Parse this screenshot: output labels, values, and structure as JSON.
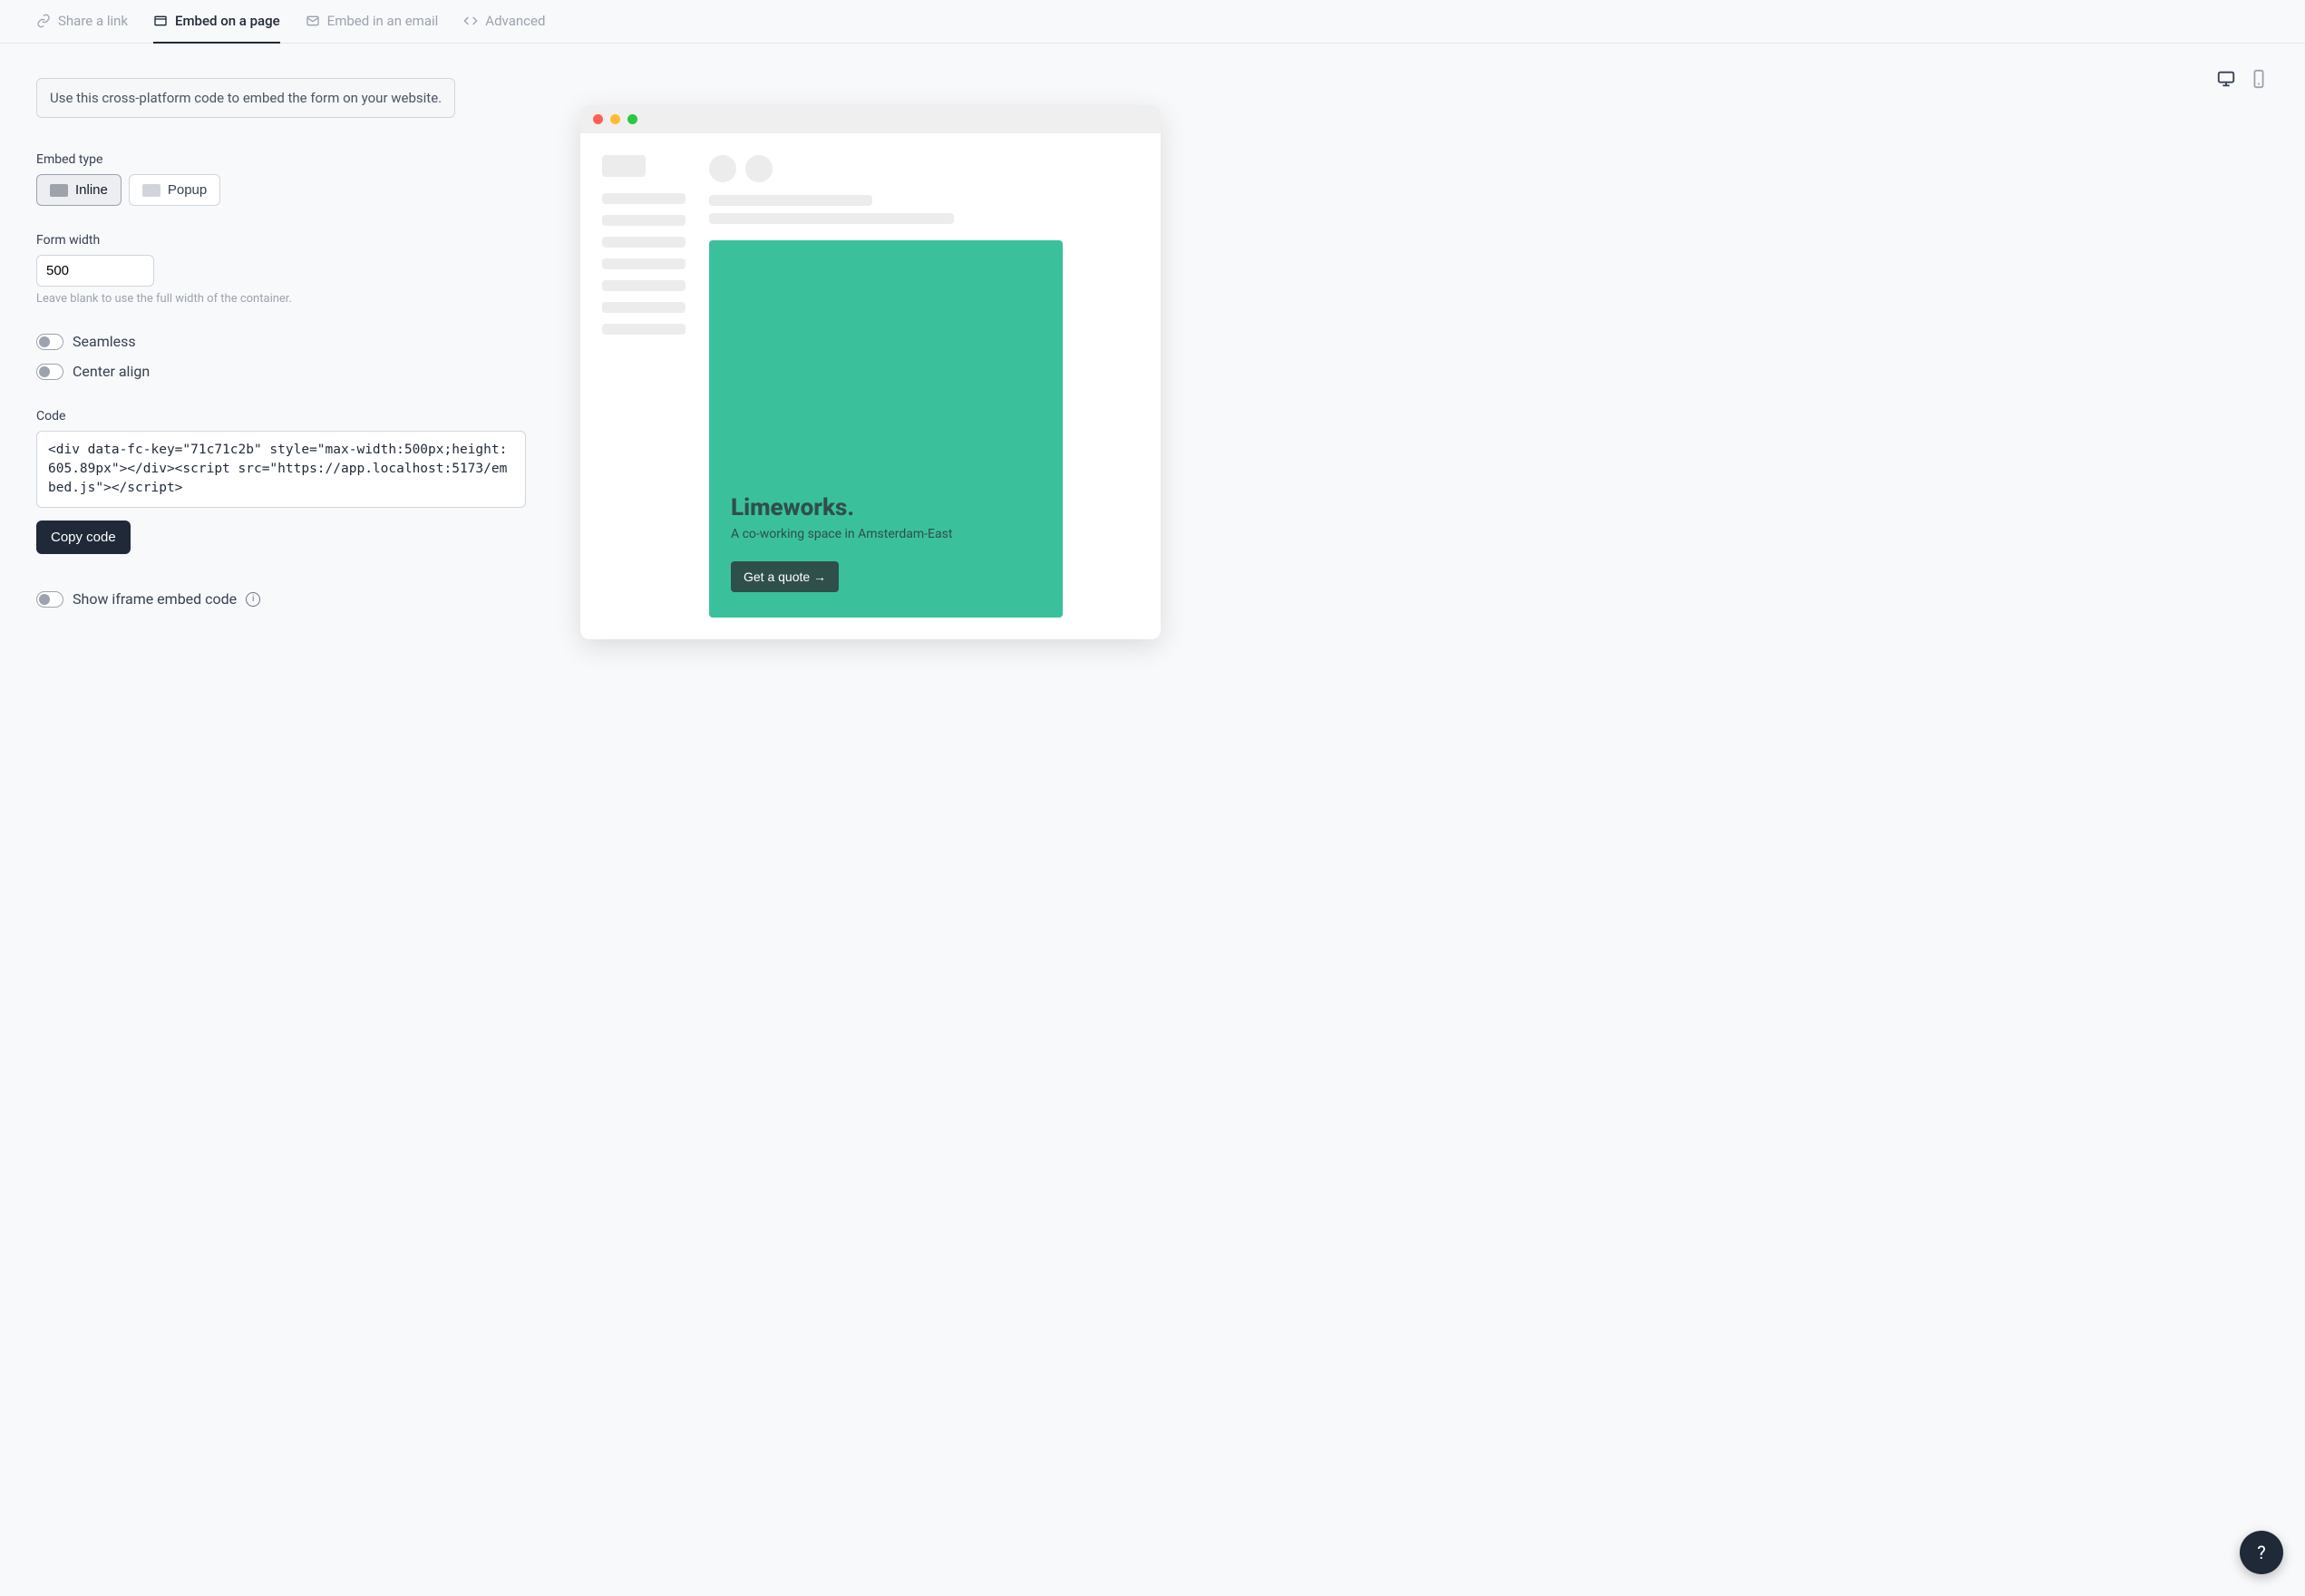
{
  "tabs": {
    "share": "Share a link",
    "embed": "Embed on a page",
    "email": "Embed in an email",
    "advanced": "Advanced"
  },
  "info": "Use this cross-platform code to embed the form on your website.",
  "embed_type": {
    "label": "Embed type",
    "inline": "Inline",
    "popup": "Popup"
  },
  "form_width": {
    "label": "Form width",
    "value": "500",
    "hint": "Leave blank to use the full width of the container."
  },
  "toggles": {
    "seamless": "Seamless",
    "center": "Center align",
    "show_iframe": "Show iframe embed code"
  },
  "code": {
    "label": "Code",
    "value": "<div data-fc-key=\"71c71c2b\" style=\"max-width:500px;height:605.89px\"></div><script src=\"https://app.localhost:5173/embed.js\"></script>",
    "copy": "Copy code"
  },
  "preview": {
    "title": "Limeworks.",
    "subtitle": "A co-working space in Amsterdam-East",
    "cta": "Get a quote →"
  },
  "help": "?"
}
